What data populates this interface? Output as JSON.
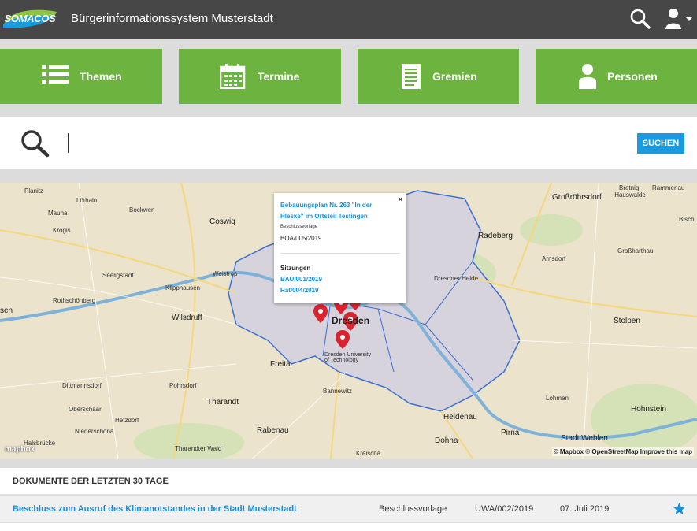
{
  "header": {
    "logo_text": "SOMACOS",
    "title": "Bürgerinformationssystem Musterstadt",
    "search_icon": "search-icon",
    "user_icon": "user-icon"
  },
  "nav": [
    {
      "label": "Themen",
      "icon": "list-icon"
    },
    {
      "label": "Termine",
      "icon": "calendar-icon"
    },
    {
      "label": "Gremien",
      "icon": "document-icon"
    },
    {
      "label": "Personen",
      "icon": "person-icon"
    }
  ],
  "search": {
    "value": "",
    "button_label": "SUCHEN"
  },
  "map": {
    "places": [
      "Planitz",
      "Löthain",
      "Mauna",
      "Bockwen",
      "Coswig",
      "Krögis",
      "Seeligstadt",
      "Klipphausen",
      "Weistrop",
      "Rothschönberg",
      "Wilsdruff",
      "Freital",
      "Pohrsdorf",
      "Tharandt",
      "Dittmannsdorf",
      "Oberschaar",
      "Hetzdorf",
      "Niederschöna",
      "Halsbrücke",
      "Rabenau",
      "Tharandter Wald",
      "Bannewitz",
      "Kreischa",
      "Dohna",
      "Heidenau",
      "Pirna",
      "Stadt Wehlen",
      "Lohmen",
      "Hohnstein",
      "Stolpen",
      "Großröhrsdorf",
      "Bretnig-Hauswalde",
      "Rammenau",
      "Bisch",
      "Radeberg",
      "Arnsdorf",
      "Großharthau",
      "Dresdner Heide",
      "Dresden",
      "Dresden University of Technology",
      "sen"
    ],
    "attribution": "© Mapbox © OpenStreetMap  Improve this map",
    "mapbox_logo": "mapbox",
    "popup": {
      "title": "Bebauungsplan Nr. 263 \"In der Hleske\" im Ortsteil Testingen",
      "type": "Beschlussvorlage",
      "number": "BOA/005/2019",
      "sessions_label": "Sitzungen",
      "sessions": [
        "BAU/001/2019",
        "Rat/004/2019"
      ],
      "close": "×"
    }
  },
  "documents": {
    "heading": "DOKUMENTE DER LETZTEN 30 TAGE",
    "rows": [
      {
        "title": "Beschluss zum Ausruf des Klimanotstandes in der Stadt Musterstadt",
        "type": "Beschlussvorlage",
        "number": "UWA/002/2019",
        "date": "07. Juli 2019",
        "icon": "star-icon"
      }
    ]
  },
  "colors": {
    "header_bg": "#474747",
    "tile_green": "#6db33f",
    "link_blue": "#1a8ed6",
    "button_blue": "#1a9be0",
    "marker_red": "#d9232e"
  }
}
